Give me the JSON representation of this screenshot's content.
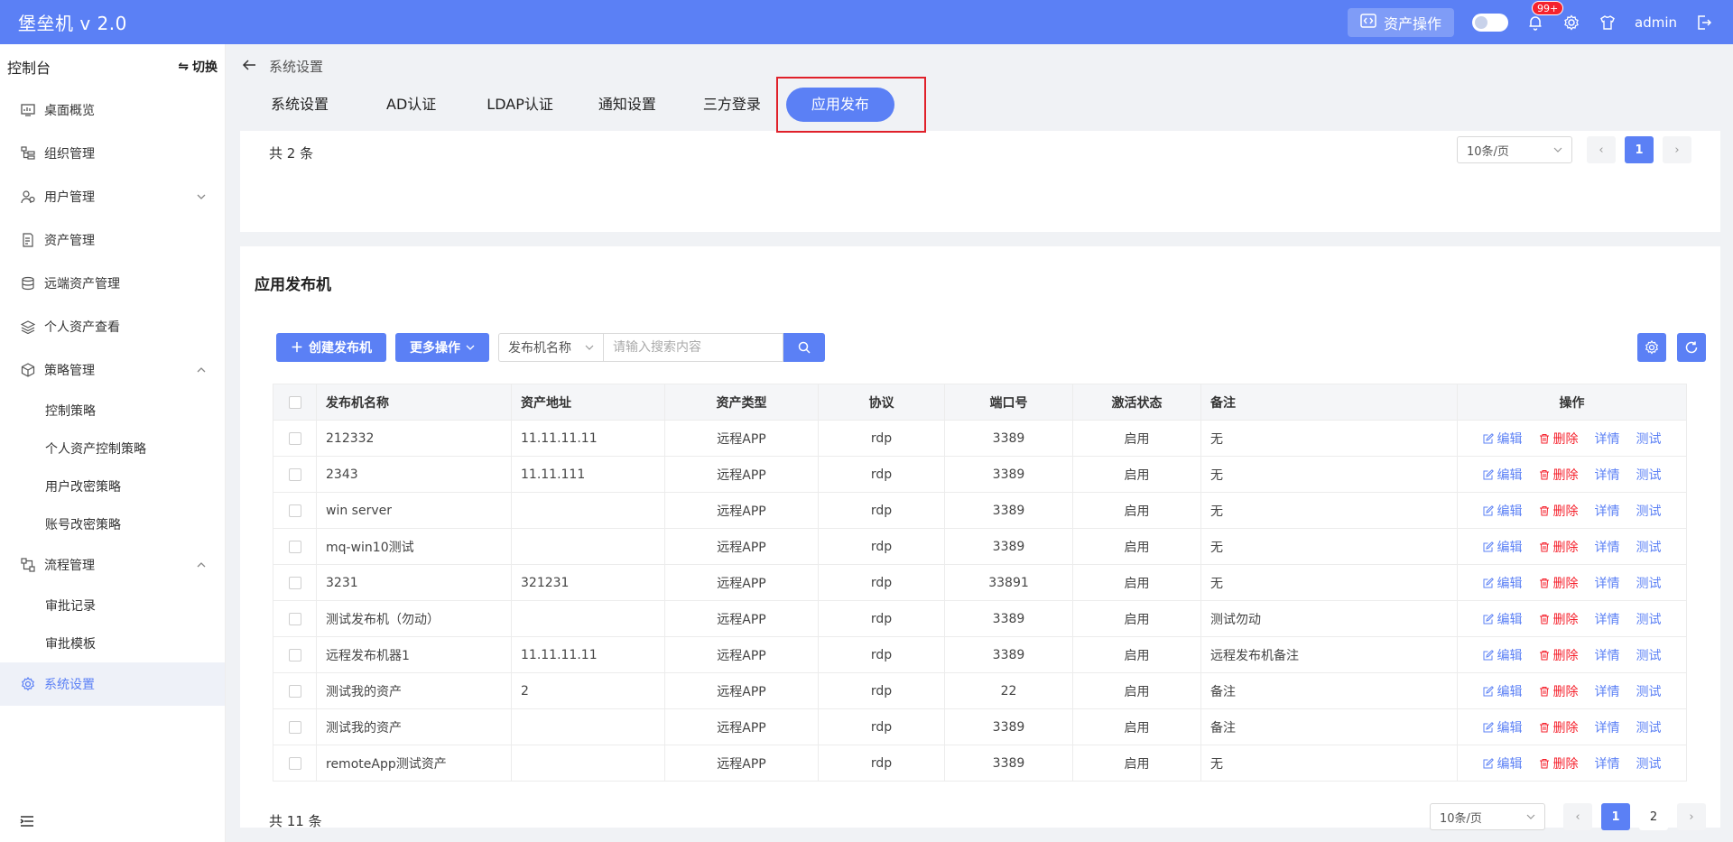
{
  "app": {
    "title": "堡垒机 v 2.0",
    "asset_op_label": "资产操作",
    "notification_badge": "99+",
    "username": "admin"
  },
  "sidebar": {
    "header_title": "控制台",
    "switch_label": "切换",
    "items": [
      {
        "label": "桌面概览",
        "icon": "dashboard-icon"
      },
      {
        "label": "组织管理",
        "icon": "org-tree-icon"
      },
      {
        "label": "用户管理",
        "icon": "users-icon",
        "expanded": false
      },
      {
        "label": "资产管理",
        "icon": "asset-icon"
      },
      {
        "label": "远端资产管理",
        "icon": "database-icon"
      },
      {
        "label": "个人资产查看",
        "icon": "layers-icon"
      },
      {
        "label": "策略管理",
        "icon": "cube-icon",
        "expanded": true
      },
      {
        "label": "控制策略"
      },
      {
        "label": "个人资产控制策略"
      },
      {
        "label": "用户改密策略"
      },
      {
        "label": "账号改密策略"
      },
      {
        "label": "流程管理",
        "icon": "flow-icon",
        "expanded": true
      },
      {
        "label": "审批记录"
      },
      {
        "label": "审批模板"
      },
      {
        "label": "系统设置",
        "icon": "gear-icon",
        "active": true
      }
    ]
  },
  "breadcrumb": {
    "title": "系统设置"
  },
  "tabs": [
    {
      "label": "系统设置"
    },
    {
      "label": "AD认证"
    },
    {
      "label": "LDAP认证"
    },
    {
      "label": "通知设置"
    },
    {
      "label": "三方登录"
    },
    {
      "label": "应用发布",
      "active": true
    }
  ],
  "top_panel": {
    "total": "共 2 条",
    "page_size": "10条/页",
    "current_page": "1"
  },
  "publisher": {
    "section_title": "应用发布机",
    "create_label": "创建发布机",
    "more_label": "更多操作",
    "search_field": "发布机名称",
    "search_placeholder": "请输入搜索内容",
    "columns": [
      "发布机名称",
      "资产地址",
      "资产类型",
      "协议",
      "端口号",
      "激活状态",
      "备注",
      "操作"
    ],
    "ops": {
      "edit": "编辑",
      "delete": "删除",
      "detail": "详情",
      "test": "测试"
    },
    "rows": [
      {
        "name": "212332",
        "address": "11.11.11.11",
        "type": "远程APP",
        "protocol": "rdp",
        "port": "3389",
        "status": "启用",
        "remark": "无"
      },
      {
        "name": "2343",
        "address": "11.11.111",
        "type": "远程APP",
        "protocol": "rdp",
        "port": "3389",
        "status": "启用",
        "remark": "无"
      },
      {
        "name": "win server",
        "address": "",
        "type": "远程APP",
        "protocol": "rdp",
        "port": "3389",
        "status": "启用",
        "remark": "无"
      },
      {
        "name": "mq-win10测试",
        "address": "",
        "type": "远程APP",
        "protocol": "rdp",
        "port": "3389",
        "status": "启用",
        "remark": "无"
      },
      {
        "name": "3231",
        "address": "321231",
        "type": "远程APP",
        "protocol": "rdp",
        "port": "33891",
        "status": "启用",
        "remark": "无"
      },
      {
        "name": "测试发布机（勿动）",
        "address": "",
        "type": "远程APP",
        "protocol": "rdp",
        "port": "3389",
        "status": "启用",
        "remark": "测试勿动"
      },
      {
        "name": "远程发布机器1",
        "address": "11.11.11.11",
        "type": "远程APP",
        "protocol": "rdp",
        "port": "3389",
        "status": "启用",
        "remark": "远程发布机备注"
      },
      {
        "name": "测试我的资产",
        "address": "2",
        "type": "远程APP",
        "protocol": "rdp",
        "port": "22",
        "status": "启用",
        "remark": "备注"
      },
      {
        "name": "测试我的资产",
        "address": "",
        "type": "远程APP",
        "protocol": "rdp",
        "port": "3389",
        "status": "启用",
        "remark": "备注"
      },
      {
        "name": "remoteApp测试资产",
        "address": "",
        "type": "远程APP",
        "protocol": "rdp",
        "port": "3389",
        "status": "启用",
        "remark": "无"
      }
    ],
    "total": "共 11 条",
    "page_size": "10条/页",
    "pages": [
      "1",
      "2"
    ],
    "current_page": "1"
  },
  "colors": {
    "brand": "#5b80f5",
    "danger": "#f5222d",
    "success": "#52c41a",
    "highlight": "#e0212a"
  }
}
